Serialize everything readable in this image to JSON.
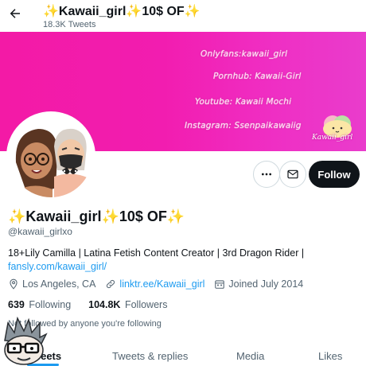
{
  "header": {
    "title": "✨Kawaii_girl✨10$ OF✨",
    "tweet_count": "18.3K Tweets",
    "back_icon": "arrow-left-icon"
  },
  "banner": {
    "lines": [
      "Onlyfans:kawaii_girl",
      "Pornhub: Kawaii-Girl",
      "Youtube: Kawaii Mochi",
      "Instagram: Ssenpaikawaiig"
    ],
    "logo_text": "Kawaii_girl",
    "colors": {
      "background": "#f31aa6"
    }
  },
  "profile": {
    "display_name": "✨Kawaii_girl✨10$ OF✨",
    "handle": "@kawaii_girlxo",
    "bio_text": "18+Lily Camilla | Latina Fetish Content Creator | 3rd Dragon Rider |",
    "bio_link": "fansly.com/kawaii_girl/",
    "location": "Los Angeles, CA",
    "website": "linktr.ee/Kawaii_girl",
    "joined": "Joined July 2014",
    "following_count": "639",
    "following_label": "Following",
    "followers_count": "104.8K",
    "followers_label": "Followers",
    "followed_by_prefix": "Not",
    "followed_by_text": "followed by anyone you're following"
  },
  "actions": {
    "more_icon": "more-icon",
    "message_icon": "envelope-icon",
    "follow_label": "Follow"
  },
  "tabs": [
    {
      "label": "Tweets",
      "active": true
    },
    {
      "label": "Tweets & replies",
      "active": false
    },
    {
      "label": "Media",
      "active": false
    },
    {
      "label": "Likes",
      "active": false
    }
  ],
  "colors": {
    "accent": "#1d9bf0",
    "text_primary": "#0f1419",
    "text_secondary": "#536471",
    "follow_button": "#0f1419"
  }
}
